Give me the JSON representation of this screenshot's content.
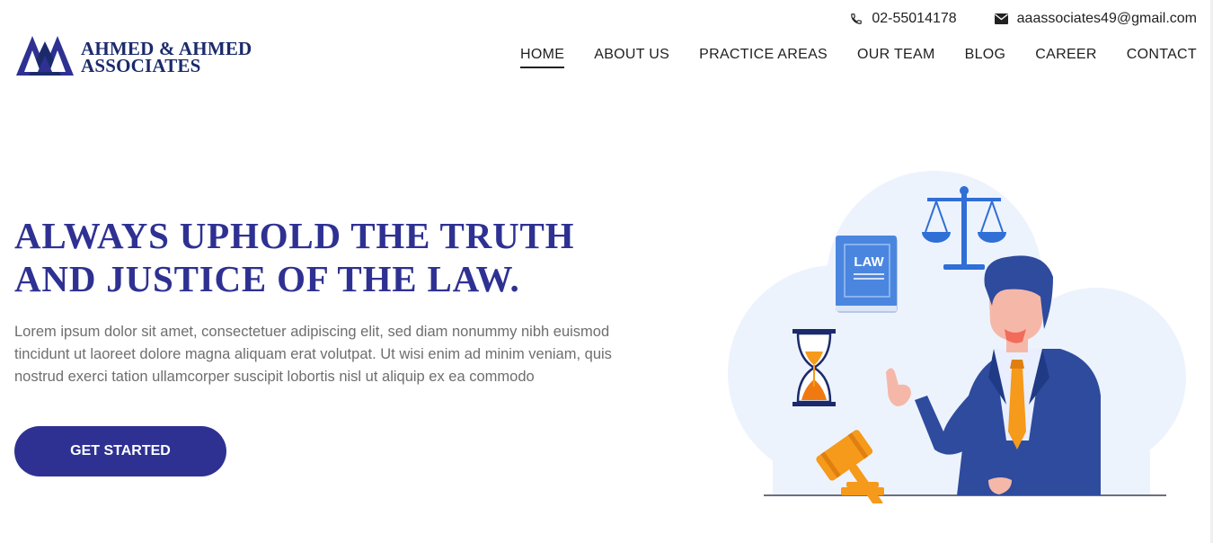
{
  "brand": {
    "line1": "AHMED & AHMED",
    "line2": "ASSOCIATES",
    "color": "#1b2a6b"
  },
  "contact": {
    "phone": "02-55014178",
    "phone_icon": "phone-icon",
    "email": "aaassociates49@gmail.com",
    "email_icon": "envelope-icon"
  },
  "nav": {
    "items": [
      {
        "label": "HOME",
        "active": true
      },
      {
        "label": "ABOUT US"
      },
      {
        "label": "PRACTICE AREAS"
      },
      {
        "label": "OUR TEAM"
      },
      {
        "label": "BLOG"
      },
      {
        "label": "CAREER"
      },
      {
        "label": "CONTACT"
      }
    ]
  },
  "hero": {
    "headline_line1": "ALWAYS UPHOLD THE TRUTH",
    "headline_line2": "AND JUSTICE OF THE LAW.",
    "body": "Lorem ipsum dolor sit amet, consectetuer adipiscing elit, sed diam nonummy nibh euismod tincidunt ut laoreet dolore magna aliquam erat volutpat. Ut wisi enim ad minim veniam, quis nostrud exerci tation ullamcorper suscipit lobortis nisl ut aliquip ex ea commodo",
    "cta_label": "GET STARTED",
    "accent": "#2e3192"
  },
  "illustration": {
    "book_label": "LAW",
    "icons": [
      "scales-icon",
      "law-book-icon",
      "hourglass-icon",
      "gavel-icon",
      "lawyer-figure"
    ]
  }
}
